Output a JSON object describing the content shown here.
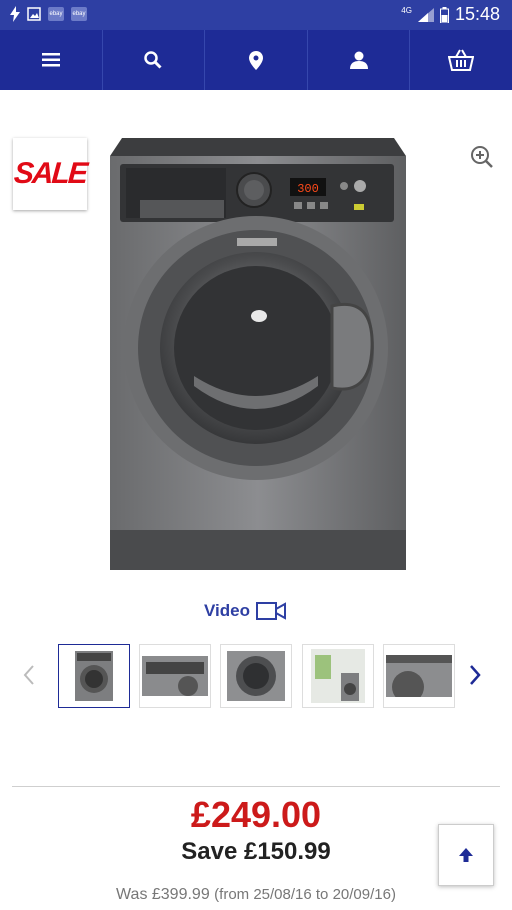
{
  "status_bar": {
    "time": "15:48",
    "network": "4G",
    "notification_icons": [
      "flash-icon",
      "image-icon",
      "ebay",
      "ebay"
    ]
  },
  "nav": {
    "items": [
      "menu-icon",
      "search-icon",
      "location-pin-icon",
      "account-icon",
      "basket-icon"
    ]
  },
  "product": {
    "sale_badge": "SALE",
    "video_label": "Video",
    "thumbnail_count": 5
  },
  "pricing": {
    "price": "£249.00",
    "save": "Save £150.99",
    "was": "Was £399.99",
    "was_dates": "(from 25/08/16 to 20/09/16)"
  },
  "colors": {
    "status_bar": "#2e3fa3",
    "nav_bar": "#1e2b96",
    "price": "#cc1a1a",
    "sale": "#e10a16"
  }
}
